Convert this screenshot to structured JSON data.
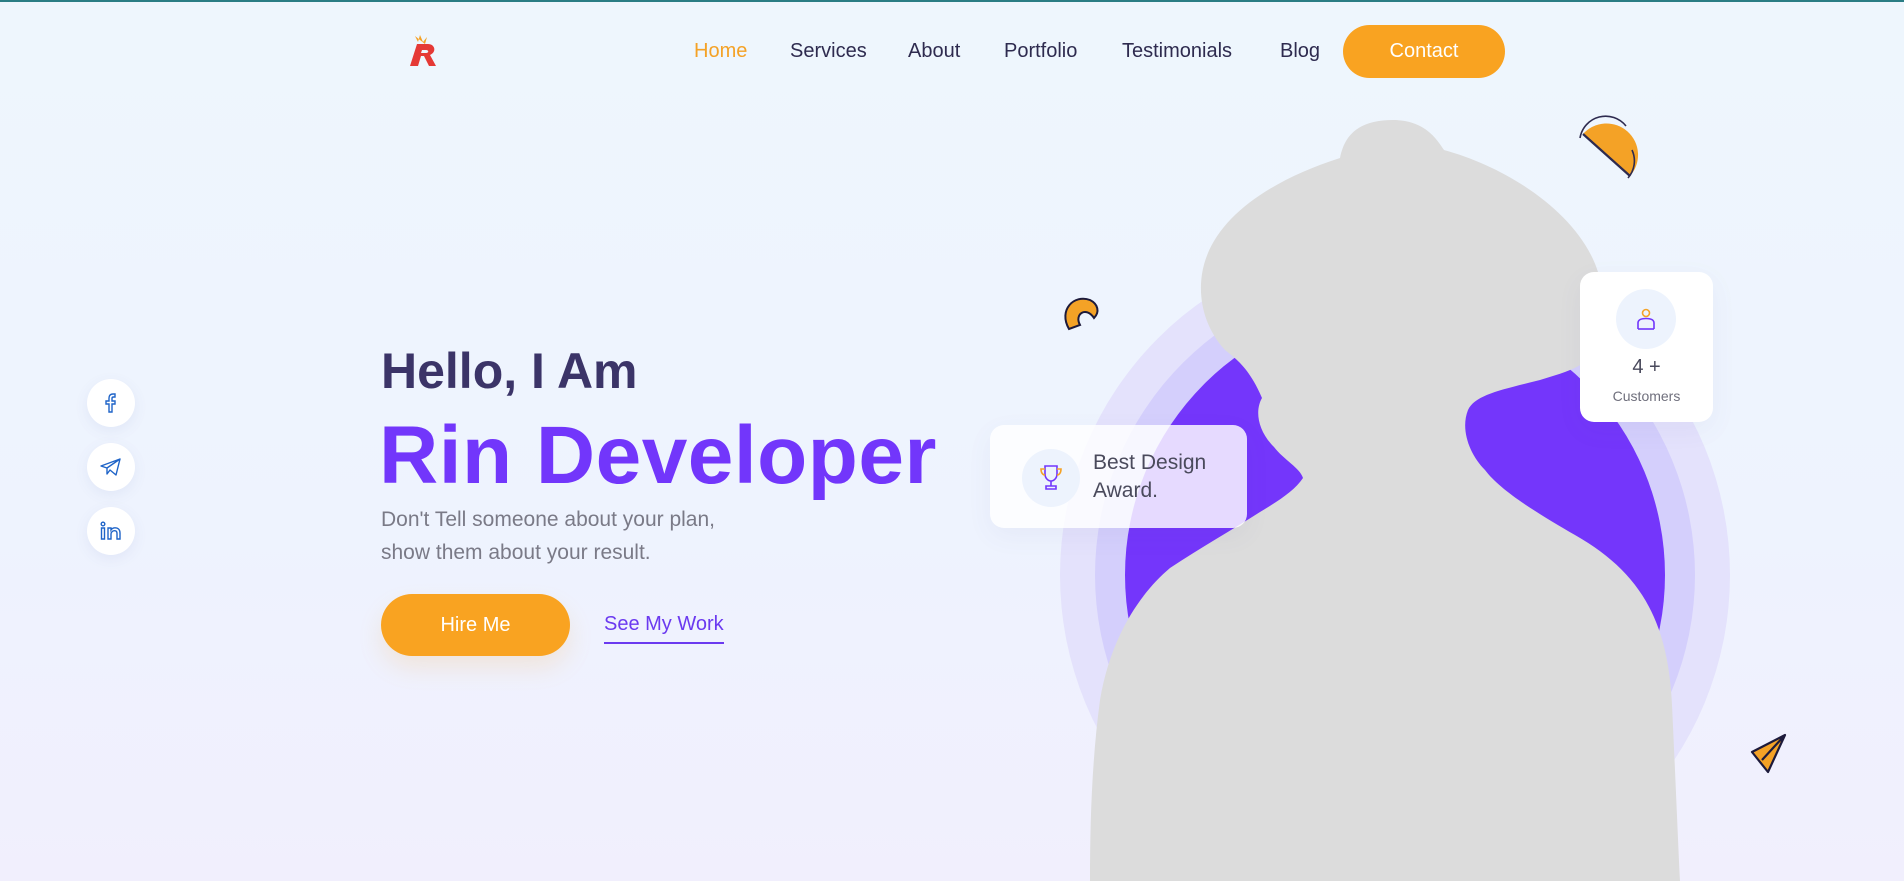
{
  "brand": {
    "logo_icon": "r-logo-icon",
    "accent": "#f9a321",
    "primary": "#7236fb"
  },
  "nav": {
    "items": [
      {
        "label": "Home",
        "active": true
      },
      {
        "label": "Services"
      },
      {
        "label": "About"
      },
      {
        "label": "Portfolio"
      },
      {
        "label": "Testimonials"
      },
      {
        "label": "Blog"
      }
    ],
    "contact_label": "Contact"
  },
  "social": [
    {
      "icon": "facebook-icon"
    },
    {
      "icon": "telegram-icon"
    },
    {
      "icon": "linkedin-icon"
    }
  ],
  "hero": {
    "greeting": "Hello, I Am",
    "name": "Rin Developer",
    "tagline_line1": "Don't Tell someone about your plan,",
    "tagline_line2": "show them about your result.",
    "hire_label": "Hire Me",
    "work_label": "See My Work"
  },
  "award": {
    "icon": "trophy-icon",
    "line1": "Best Design",
    "line2": "Award."
  },
  "customers": {
    "icon": "user-icon",
    "count": "4 +",
    "label": "Customers"
  },
  "decor": [
    "half-circle-shape-icon",
    "arc-shape-icon",
    "paper-plane-shape-icon"
  ]
}
